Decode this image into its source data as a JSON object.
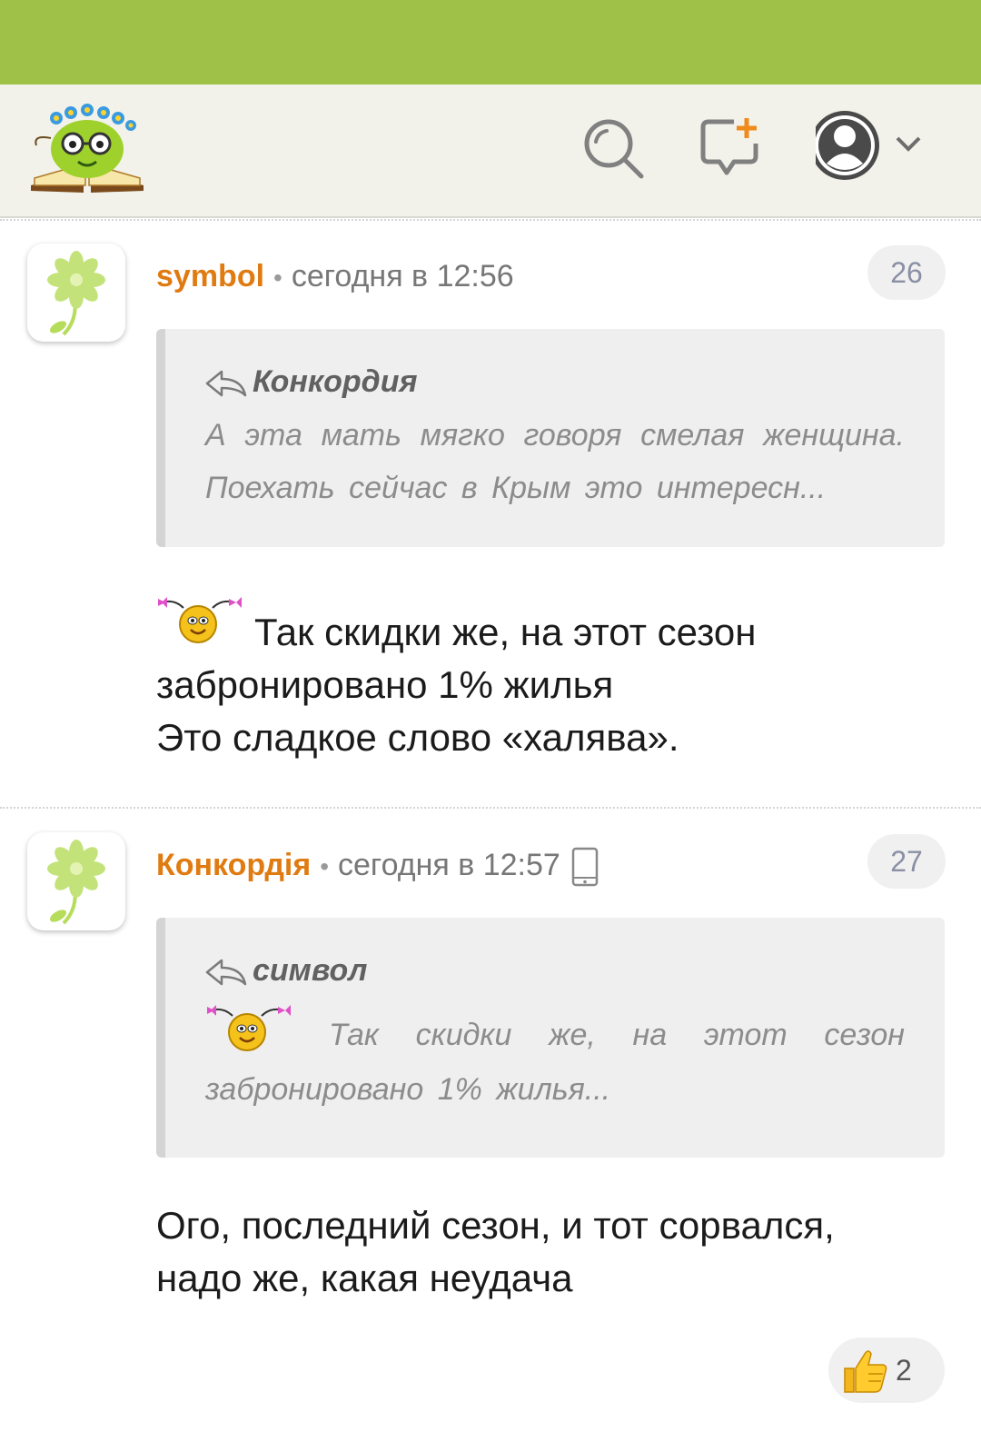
{
  "header": {
    "logo_icon": "book-mascot-logo",
    "search_icon": "search-icon",
    "new_post_icon": "new-message-icon",
    "profile_icon": "user-avatar-icon"
  },
  "comments": [
    {
      "author": "symbol",
      "separator": "•",
      "time": "сегодня в 12:56",
      "number": "26",
      "quote": {
        "author": "Конкордия",
        "text": "А эта мать мягко говоря смелая женщина. Поехать сейчас в Крым это интересн..."
      },
      "lines": [
        "Так скидки же, на этот сезон",
        "забронировано 1% жилья",
        "Это сладкое слово «халява»."
      ]
    },
    {
      "author": "Конкордія",
      "separator": "•",
      "time": "сегодня в 12:57",
      "device_icon": "mobile-phone-icon",
      "number": "27",
      "quote": {
        "author": "символ",
        "line1": "Так скидки же, на этот сезон",
        "line2": "забронировано 1% жилья..."
      },
      "lines": [
        "Ого, последний сезон, и тот сорвался,",
        "надо же, какая неудача"
      ],
      "likes": "2"
    }
  ],
  "colors": {
    "status_bar": "#9fc147",
    "header_bg": "#f2f2ea",
    "author": "#e07b12"
  }
}
